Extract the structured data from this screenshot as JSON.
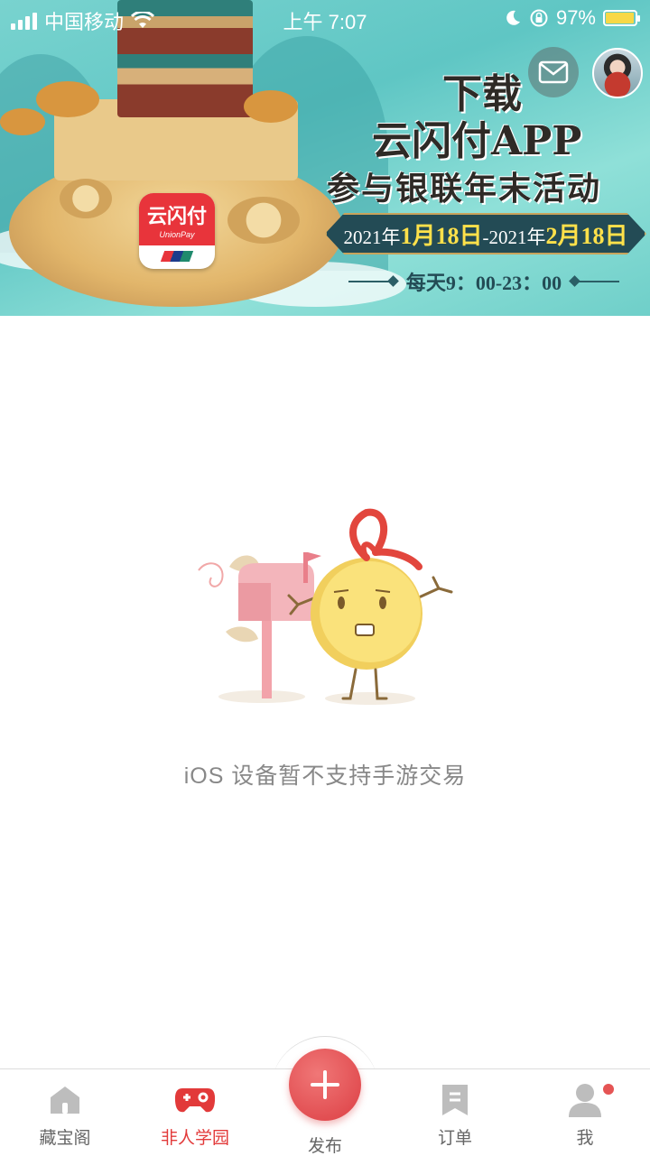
{
  "status_bar": {
    "carrier": "中国移动",
    "time": "上午 7:07",
    "battery_percent": "97%",
    "battery_level": 0.97,
    "icons": [
      "signal-icon",
      "wifi-icon",
      "moon-icon",
      "rotation-lock-icon",
      "battery-icon"
    ]
  },
  "banner": {
    "line1": "下载",
    "line2": "云闪付APP",
    "line3": "参与银联年末活动",
    "date_prefix1": "2021年",
    "date_hl1": "1月18日",
    "date_mid": "-2021年",
    "date_hl2": "2月18日",
    "hours": "每天9：00-23：00",
    "app_icon_name": "云闪付",
    "app_icon_brand": "UnionPay"
  },
  "header_actions": {
    "mail_icon": "mail-icon",
    "avatar": "user-avatar"
  },
  "empty_state": {
    "message": "iOS 设备暂不支持手游交易"
  },
  "tab_bar": {
    "tabs": [
      {
        "label": "藏宝阁",
        "icon": "home-icon",
        "active": false
      },
      {
        "label": "非人学园",
        "icon": "gamepad-icon",
        "active": true
      },
      {
        "label": "发布",
        "icon": "plus-icon",
        "active": false
      },
      {
        "label": "订单",
        "icon": "order-icon",
        "active": false
      },
      {
        "label": "我",
        "icon": "profile-icon",
        "active": false
      }
    ],
    "accent_color": "#e23a3a",
    "inactive_color": "#666666",
    "badge_color": "#e55454"
  }
}
